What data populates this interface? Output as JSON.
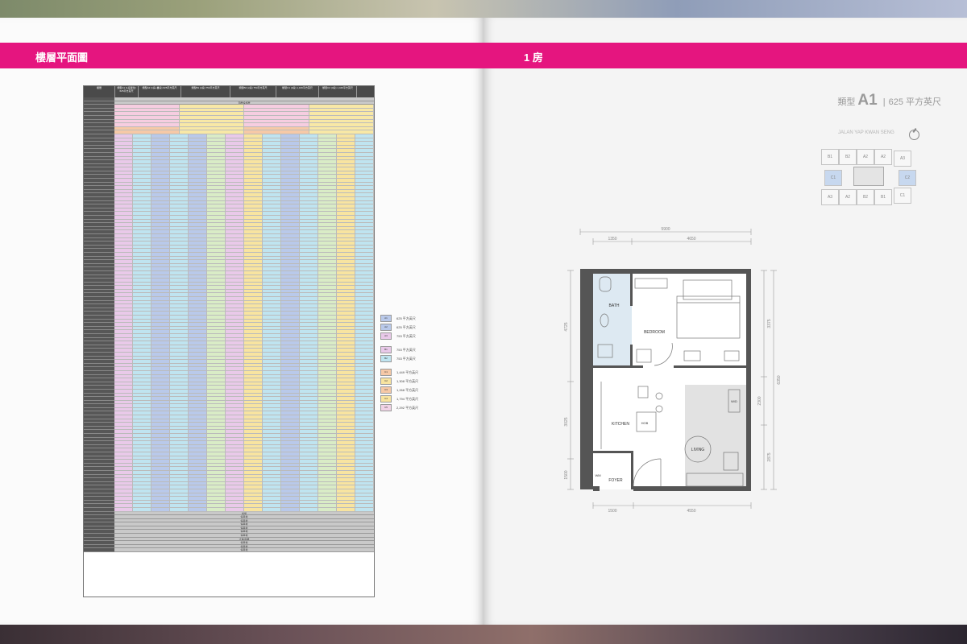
{
  "left_page": {
    "header": "樓層平面圖",
    "table": {
      "header_cells": [
        "樓層",
        "類型A1\n(1房單位)\n625平方英尺",
        "類型A2\n(1房+書房)\n625平方英尺",
        "類型B1\n(2房)\n753平方英尺",
        "類型B2\n(2房)\n753平方英尺",
        "類型C1\n(3房)\n1,169平方英尺",
        "類型C2\n(3房)\n1,449平方英尺"
      ],
      "top_spans": [
        "",
        "頂層設施層"
      ],
      "bottom_spans": [
        "設施",
        "停車場",
        "停車場",
        "停車場",
        "停車場",
        "停車場",
        "停車場",
        "大堂/商業",
        "停車場",
        "停車場",
        "停車場"
      ]
    },
    "legend": {
      "groups": [
        [
          {
            "code": "A1",
            "label": "625 平方英尺",
            "color": "#b9c9ea"
          },
          {
            "code": "A2",
            "label": "625 平方英尺",
            "color": "#b9c9ea"
          },
          {
            "code": "A3",
            "label": "753 平方英尺",
            "color": "#e9c9e9"
          }
        ],
        [
          {
            "code": "B1",
            "label": "753 平方英尺",
            "color": "#e9c9e9"
          },
          {
            "code": "B2",
            "label": "753 平方英尺",
            "color": "#bfe4f0"
          }
        ],
        [
          {
            "code": "C1",
            "label": "1,449 平方英尺",
            "color": "#f6c9a7"
          },
          {
            "code": "C2",
            "label": "1,308 平方英尺",
            "color": "#f8e4a0"
          },
          {
            "code": "C3",
            "label": "1,268 平方英尺",
            "color": "#f6c9a7"
          },
          {
            "code": "C4",
            "label": "1,794 平方英尺",
            "color": "#f8e4a0"
          },
          {
            "code": "C5",
            "label": "2,292 平方英尺",
            "color": "#f1d3e6"
          }
        ]
      ]
    }
  },
  "right_page": {
    "header": "1 房",
    "unit_title": {
      "prefix": "類型",
      "type": "A1",
      "separator": "|",
      "area": "625 平方英尺"
    },
    "keyplan": {
      "street": "JALAN YAP KWAN SENG",
      "units": [
        "B1",
        "B2",
        "A2",
        "A2",
        "A3",
        "C1",
        "C2",
        "A3",
        "A2",
        "B2",
        "B1",
        "C1"
      ]
    },
    "floor_plan": {
      "rooms": {
        "bath": "BATH",
        "bedroom": "BEDROOM",
        "kitchen": "KITCHEN",
        "living": "LIVING",
        "foyer": "FOYER",
        "hob": "HOB",
        "wm": "WM",
        "wd": "W/D"
      },
      "dims": {
        "top_total": "5900",
        "top_left": "1350",
        "top_right": "4650",
        "bottom_left": "1500",
        "bottom_right": "4550",
        "left_top": "4725",
        "left_mid": "3025",
        "left_bottom": "1500",
        "right_top": "3375",
        "right_total": "6350",
        "right_mid": "2300",
        "right_bottom": "2875"
      }
    }
  },
  "colors": {
    "accent": "#e5157f"
  }
}
